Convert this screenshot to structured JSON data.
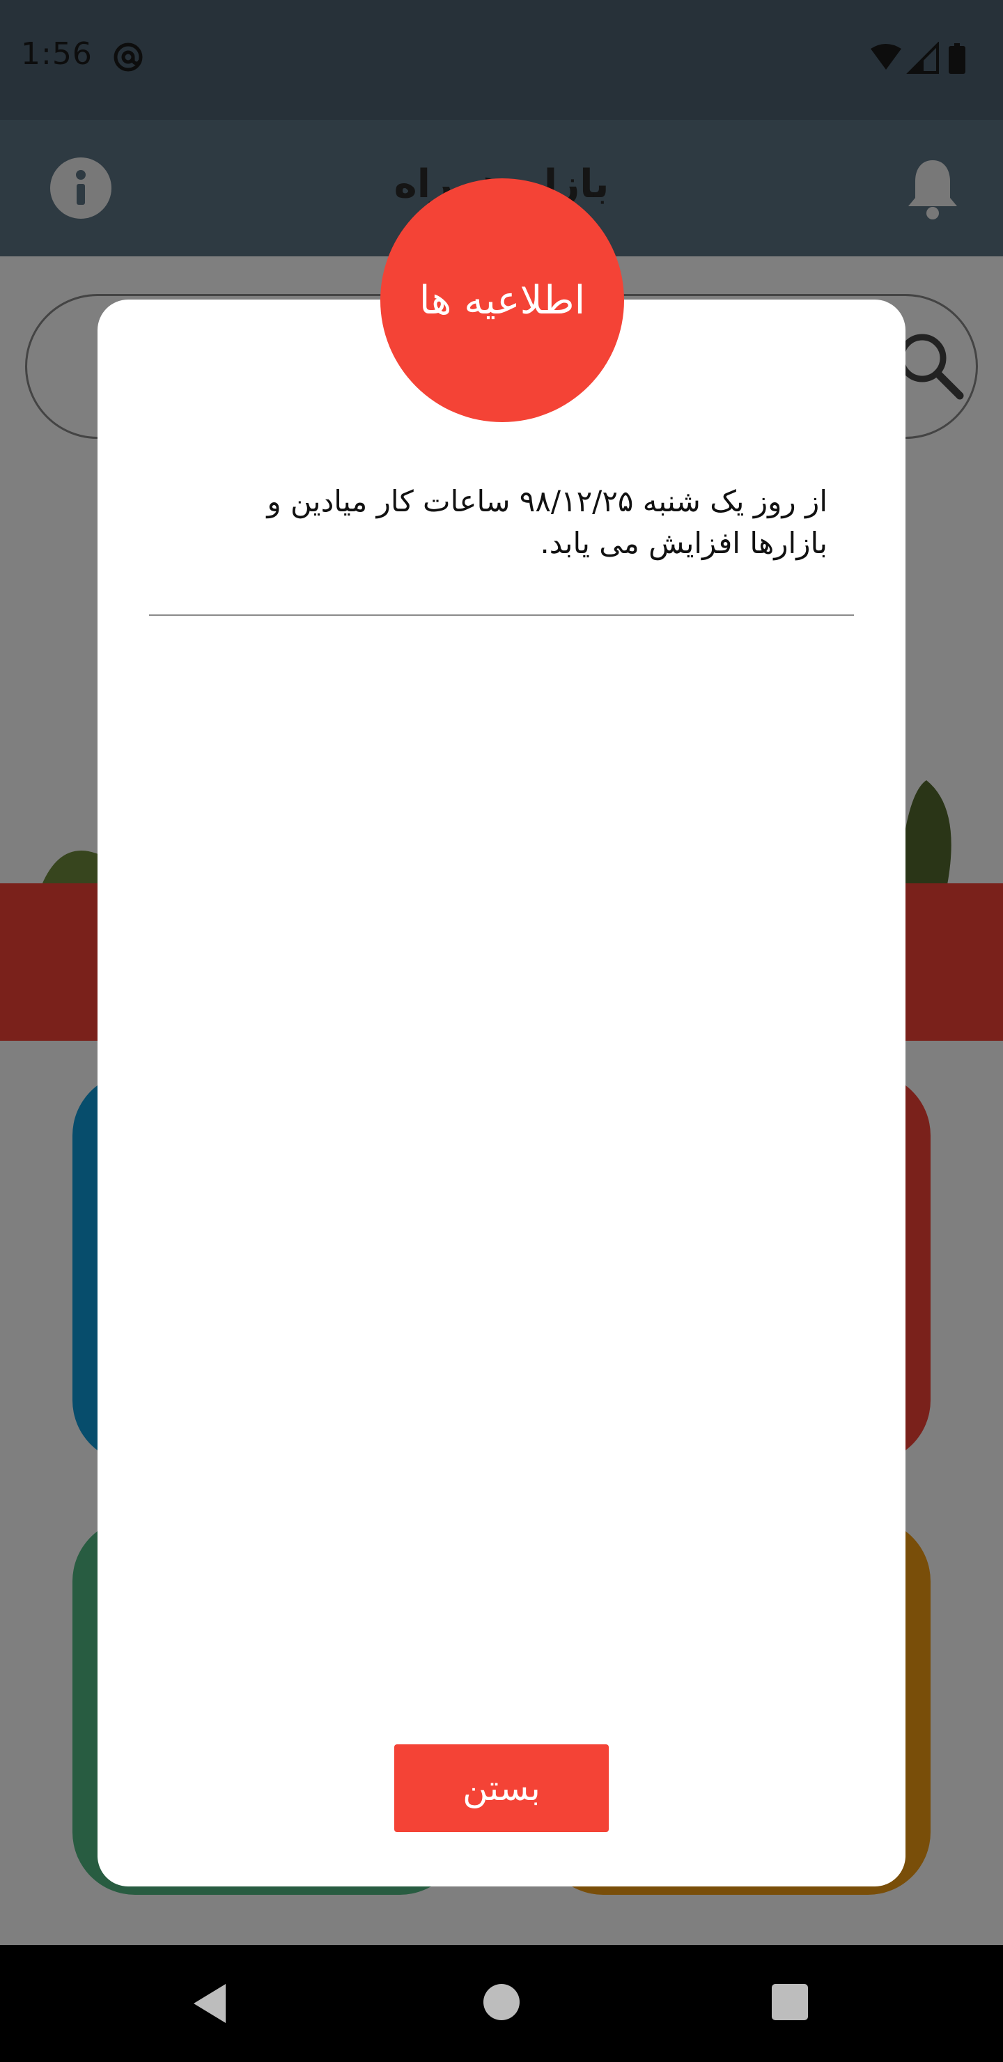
{
  "status_bar": {
    "time": "1:56",
    "icons": [
      "at-sign-icon",
      "wifi-icon",
      "signal-icon",
      "battery-icon"
    ]
  },
  "app_bar": {
    "title": "بازار همراه",
    "left_icon": "info-icon",
    "right_icon": "bell-icon"
  },
  "dialog": {
    "title": "اطلاعیه ها",
    "message": "از روز یک شنبه ۹۸/۱۲/۲۵ ساعات کار میادین و بازارها افزایش می یابد.",
    "close_label": "بستن"
  },
  "nav_bar": {
    "icons": [
      "back-icon",
      "home-icon",
      "recents-icon"
    ]
  },
  "colors": {
    "accent": "#f44336",
    "app_bar": "#5d7485",
    "tile_blue": "#0f9ad8",
    "tile_green": "#51b882",
    "tile_orange": "#f39c12"
  }
}
